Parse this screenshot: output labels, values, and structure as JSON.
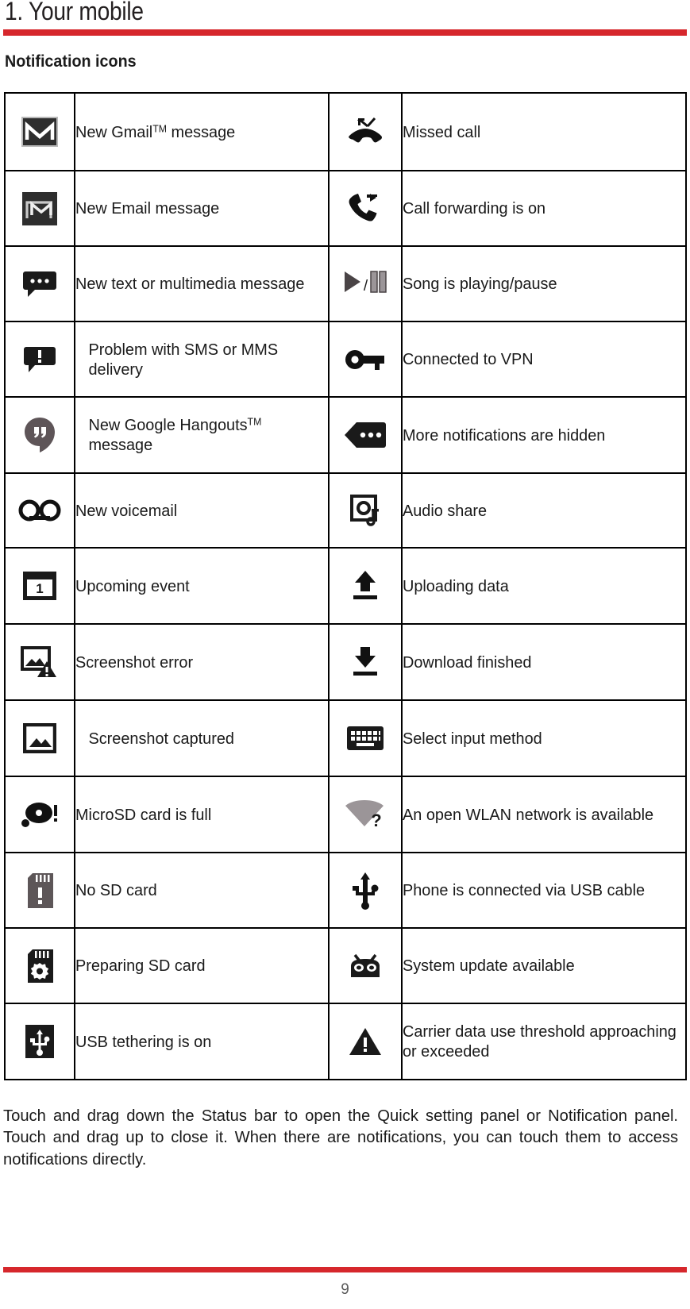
{
  "document": {
    "chapter_title": "1. Your mobile",
    "section_title": "Notification icons",
    "page_number": "9",
    "accent_color": "#d6272c"
  },
  "table": {
    "rows": [
      {
        "left_icon": "gmail-icon",
        "left_label": "New Gmail",
        "left_label_tm": "TM",
        "left_label_tail": " message",
        "right_icon": "missed-call-icon",
        "right_label": "Missed call"
      },
      {
        "left_icon": "email-icon",
        "left_label": "New Email message",
        "right_icon": "call-forwarding-icon",
        "right_label": "Call forwarding is on"
      },
      {
        "left_icon": "sms-message-icon",
        "left_label": "New text or multimedia message",
        "right_icon": "play-pause-icon",
        "right_label": "Song is playing/pause"
      },
      {
        "left_icon": "sms-problem-icon",
        "left_label": "Problem with SMS or MMS delivery",
        "right_icon": "vpn-key-icon",
        "right_label": "Connected to VPN"
      },
      {
        "left_icon": "hangouts-icon",
        "left_label": "New Google Hangouts",
        "left_label_tm": "TM",
        "left_label_tail": " message",
        "right_icon": "more-notifications-icon",
        "right_label": "More notifications are hidden"
      },
      {
        "left_icon": "voicemail-icon",
        "left_label": "New voicemail",
        "right_icon": "audio-share-icon",
        "right_label": "Audio share"
      },
      {
        "left_icon": "calendar-event-icon",
        "left_label": "Upcoming event",
        "right_icon": "upload-icon",
        "right_label": "Uploading data"
      },
      {
        "left_icon": "screenshot-error-icon",
        "left_label": "Screenshot error",
        "right_icon": "download-icon",
        "right_label": "Download finished"
      },
      {
        "left_icon": "screenshot-captured-icon",
        "left_label": "Screenshot captured",
        "right_icon": "keyboard-icon",
        "right_label": "Select input method"
      },
      {
        "left_icon": "microsd-full-icon",
        "left_label": "MicroSD card is full",
        "right_icon": "open-wlan-icon",
        "right_label": "An open WLAN network is available"
      },
      {
        "left_icon": "no-sd-card-icon",
        "left_label": "No SD card",
        "right_icon": "usb-icon",
        "right_label": "Phone is connected via USB cable"
      },
      {
        "left_icon": "preparing-sd-card-icon",
        "left_label": "Preparing SD card",
        "right_icon": "android-update-icon",
        "right_label": "System update available"
      },
      {
        "left_icon": "usb-tethering-icon",
        "left_label": "USB tethering is on",
        "right_icon": "warning-icon",
        "right_label": "Carrier data use threshold approaching or exceeded"
      }
    ]
  },
  "body_paragraph": "Touch and drag down the Status bar to open the Quick setting panel or Notification panel. Touch and drag up to close it. When there are notifications, you can touch them to access notifications directly."
}
